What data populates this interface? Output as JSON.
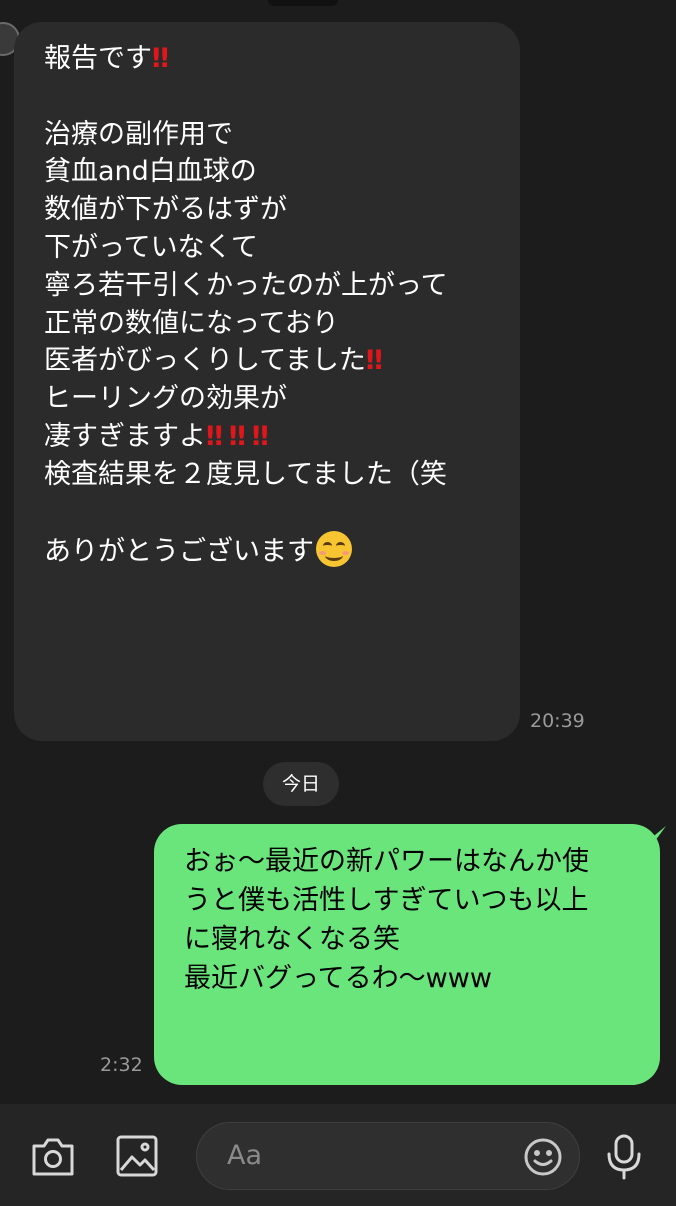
{
  "incoming": {
    "lines": [
      {
        "text": "報告です",
        "marks": "‼"
      },
      {
        "text": ""
      },
      {
        "text": "治療の副作用で"
      },
      {
        "text": "貧血and白血球の"
      },
      {
        "text": "数値が下がるはずが"
      },
      {
        "text": "下がっていなくて"
      },
      {
        "text": "寧ろ若干引くかったのが上がって"
      },
      {
        "text": "正常の数値になっており"
      },
      {
        "text": "医者がびっくりしてました",
        "marks": "‼"
      },
      {
        "text": "ヒーリングの効果が"
      },
      {
        "text": "凄すぎますよ",
        "marks": "‼‼‼"
      },
      {
        "text": "検査結果を２度見してました（笑"
      },
      {
        "text": ""
      },
      {
        "text": "ありがとうございます"
      }
    ],
    "emoji": "smiling-face-emoji",
    "time": "20:39"
  },
  "date_separator": "今日",
  "outgoing": {
    "lines": [
      "おぉ〜最近の新パワーはなんか使",
      "うと僕も活性しすぎていつも以上",
      "に寝れなくなる笑",
      "最近バグってるわ〜www"
    ],
    "time": "2:32"
  },
  "composer": {
    "placeholder": "Aa",
    "icons": [
      "camera-icon",
      "image-icon",
      "emoji-icon",
      "microphone-icon"
    ]
  },
  "colors": {
    "background": "#1c1c1c",
    "incoming_bubble": "#2b2b2b",
    "outgoing_bubble": "#6ae57b",
    "exclamation": "#e0161a"
  }
}
